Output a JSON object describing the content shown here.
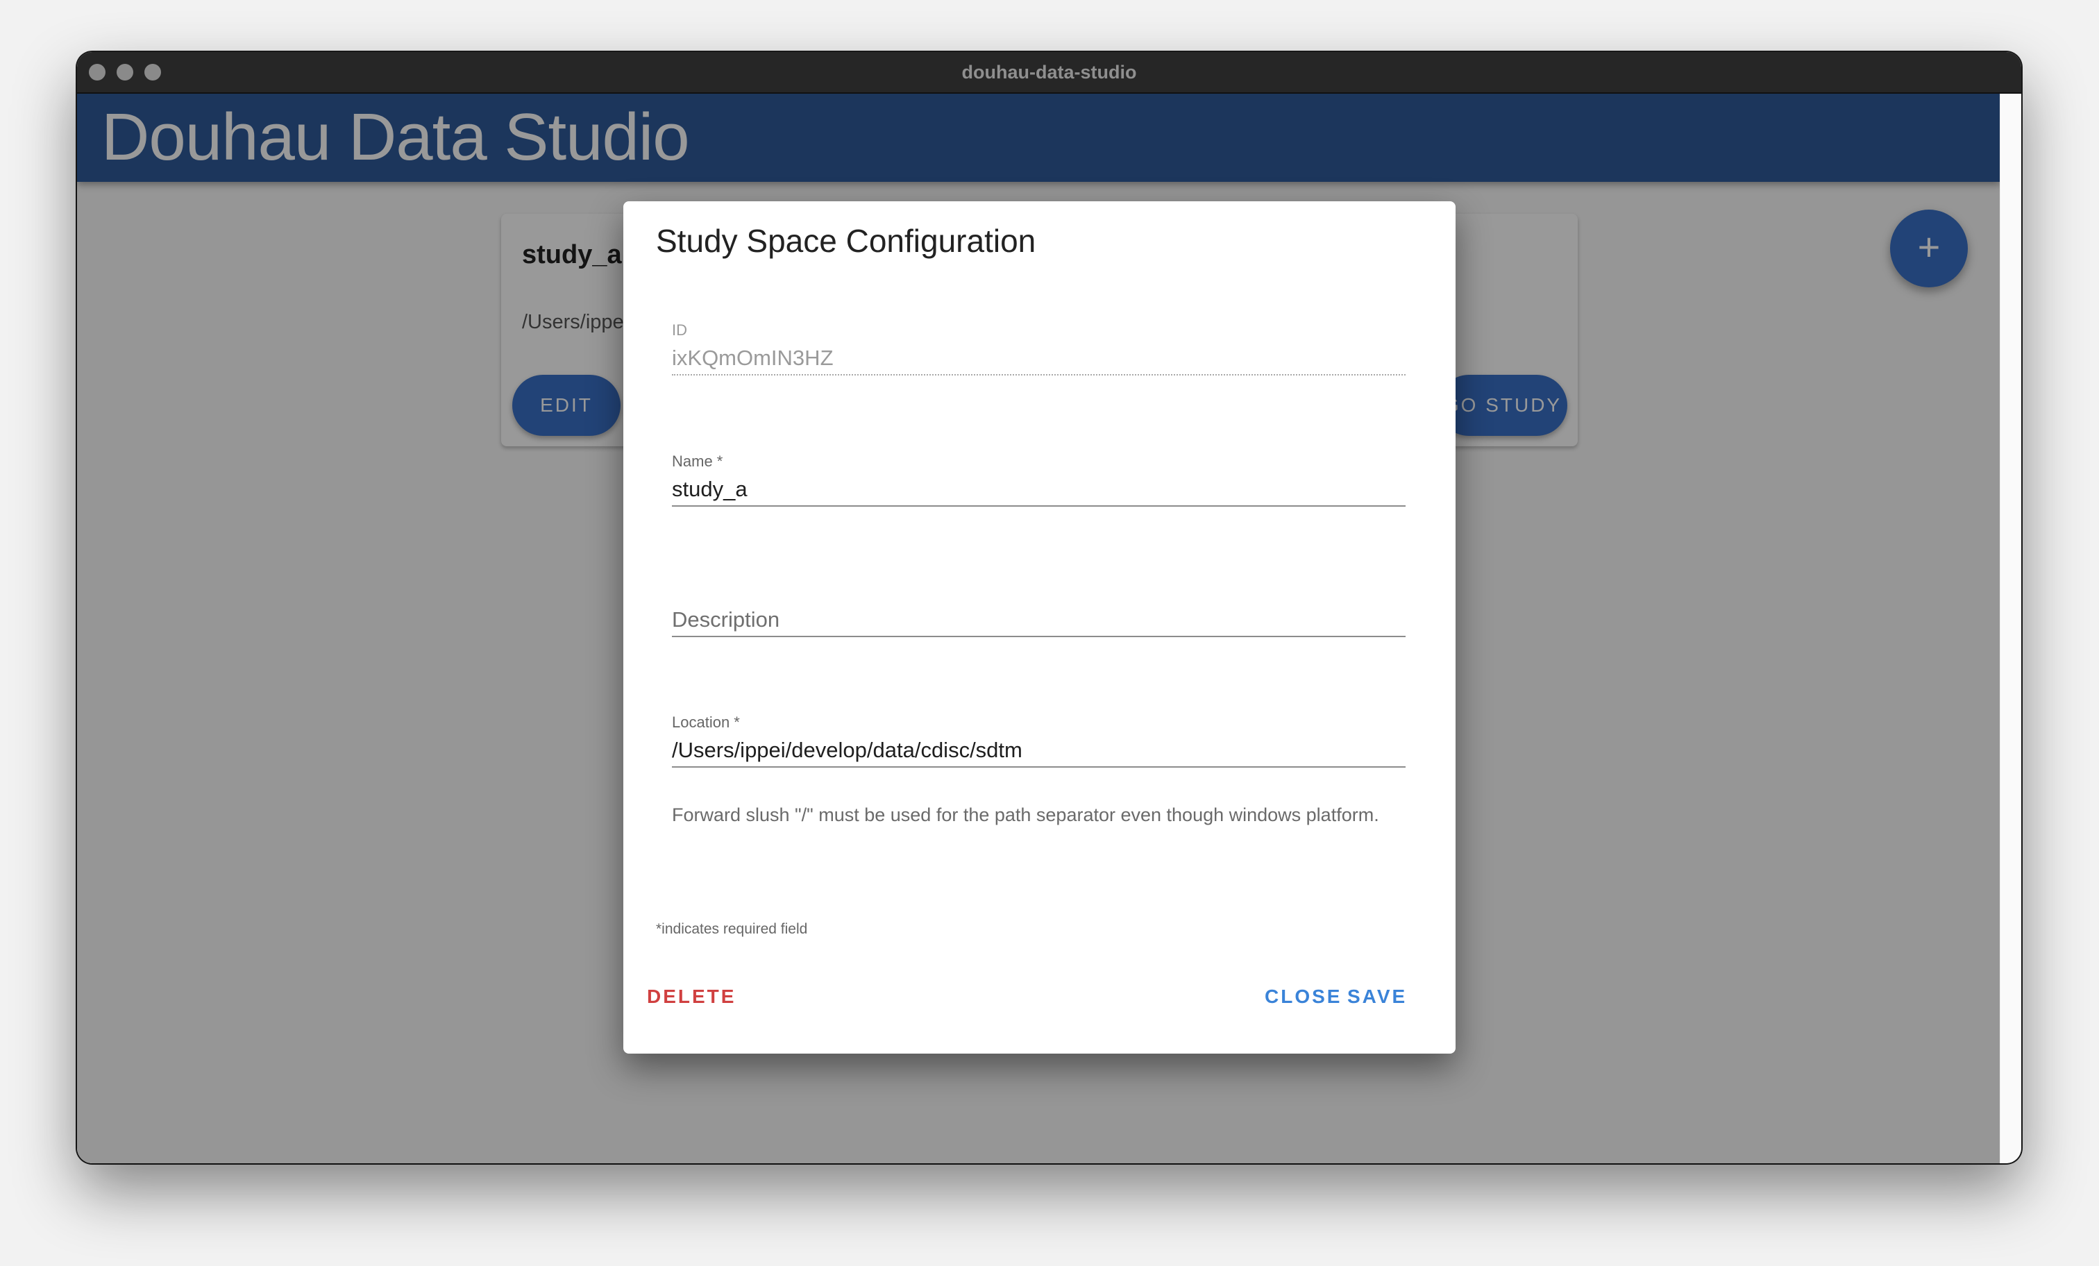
{
  "window": {
    "title": "douhau-data-studio",
    "controls": [
      "close",
      "minimize",
      "maximize"
    ]
  },
  "appbar": {
    "title": "Douhau Data Studio"
  },
  "background_card": {
    "title": "study_a",
    "path": "/Users/ippei/develop/data/cdisc/sdtm",
    "edit_label": "EDIT",
    "go_label": "GO STUDY"
  },
  "fab": {
    "icon": "plus-icon",
    "glyph": "+"
  },
  "dialog": {
    "title": "Study Space Configuration",
    "fields": {
      "id": {
        "label": "ID",
        "value": "ixKQmOmIN3HZ"
      },
      "name": {
        "label": "Name *",
        "value": "study_a"
      },
      "description": {
        "label": "Description",
        "value": ""
      },
      "location": {
        "label": "Location *",
        "value": "/Users/ippei/develop/data/cdisc/sdtm"
      }
    },
    "helper_text": "Forward slush \"/\" must be used for the path separator even though windows platform.",
    "required_note": "*indicates required field",
    "actions": {
      "delete": "DELETE",
      "close": "CLOSE",
      "save": "SAVE"
    }
  },
  "colors": {
    "primary": "#3a70c6",
    "appbar": "#2f5a9a",
    "danger": "#d04040",
    "action": "#3a83d8"
  }
}
